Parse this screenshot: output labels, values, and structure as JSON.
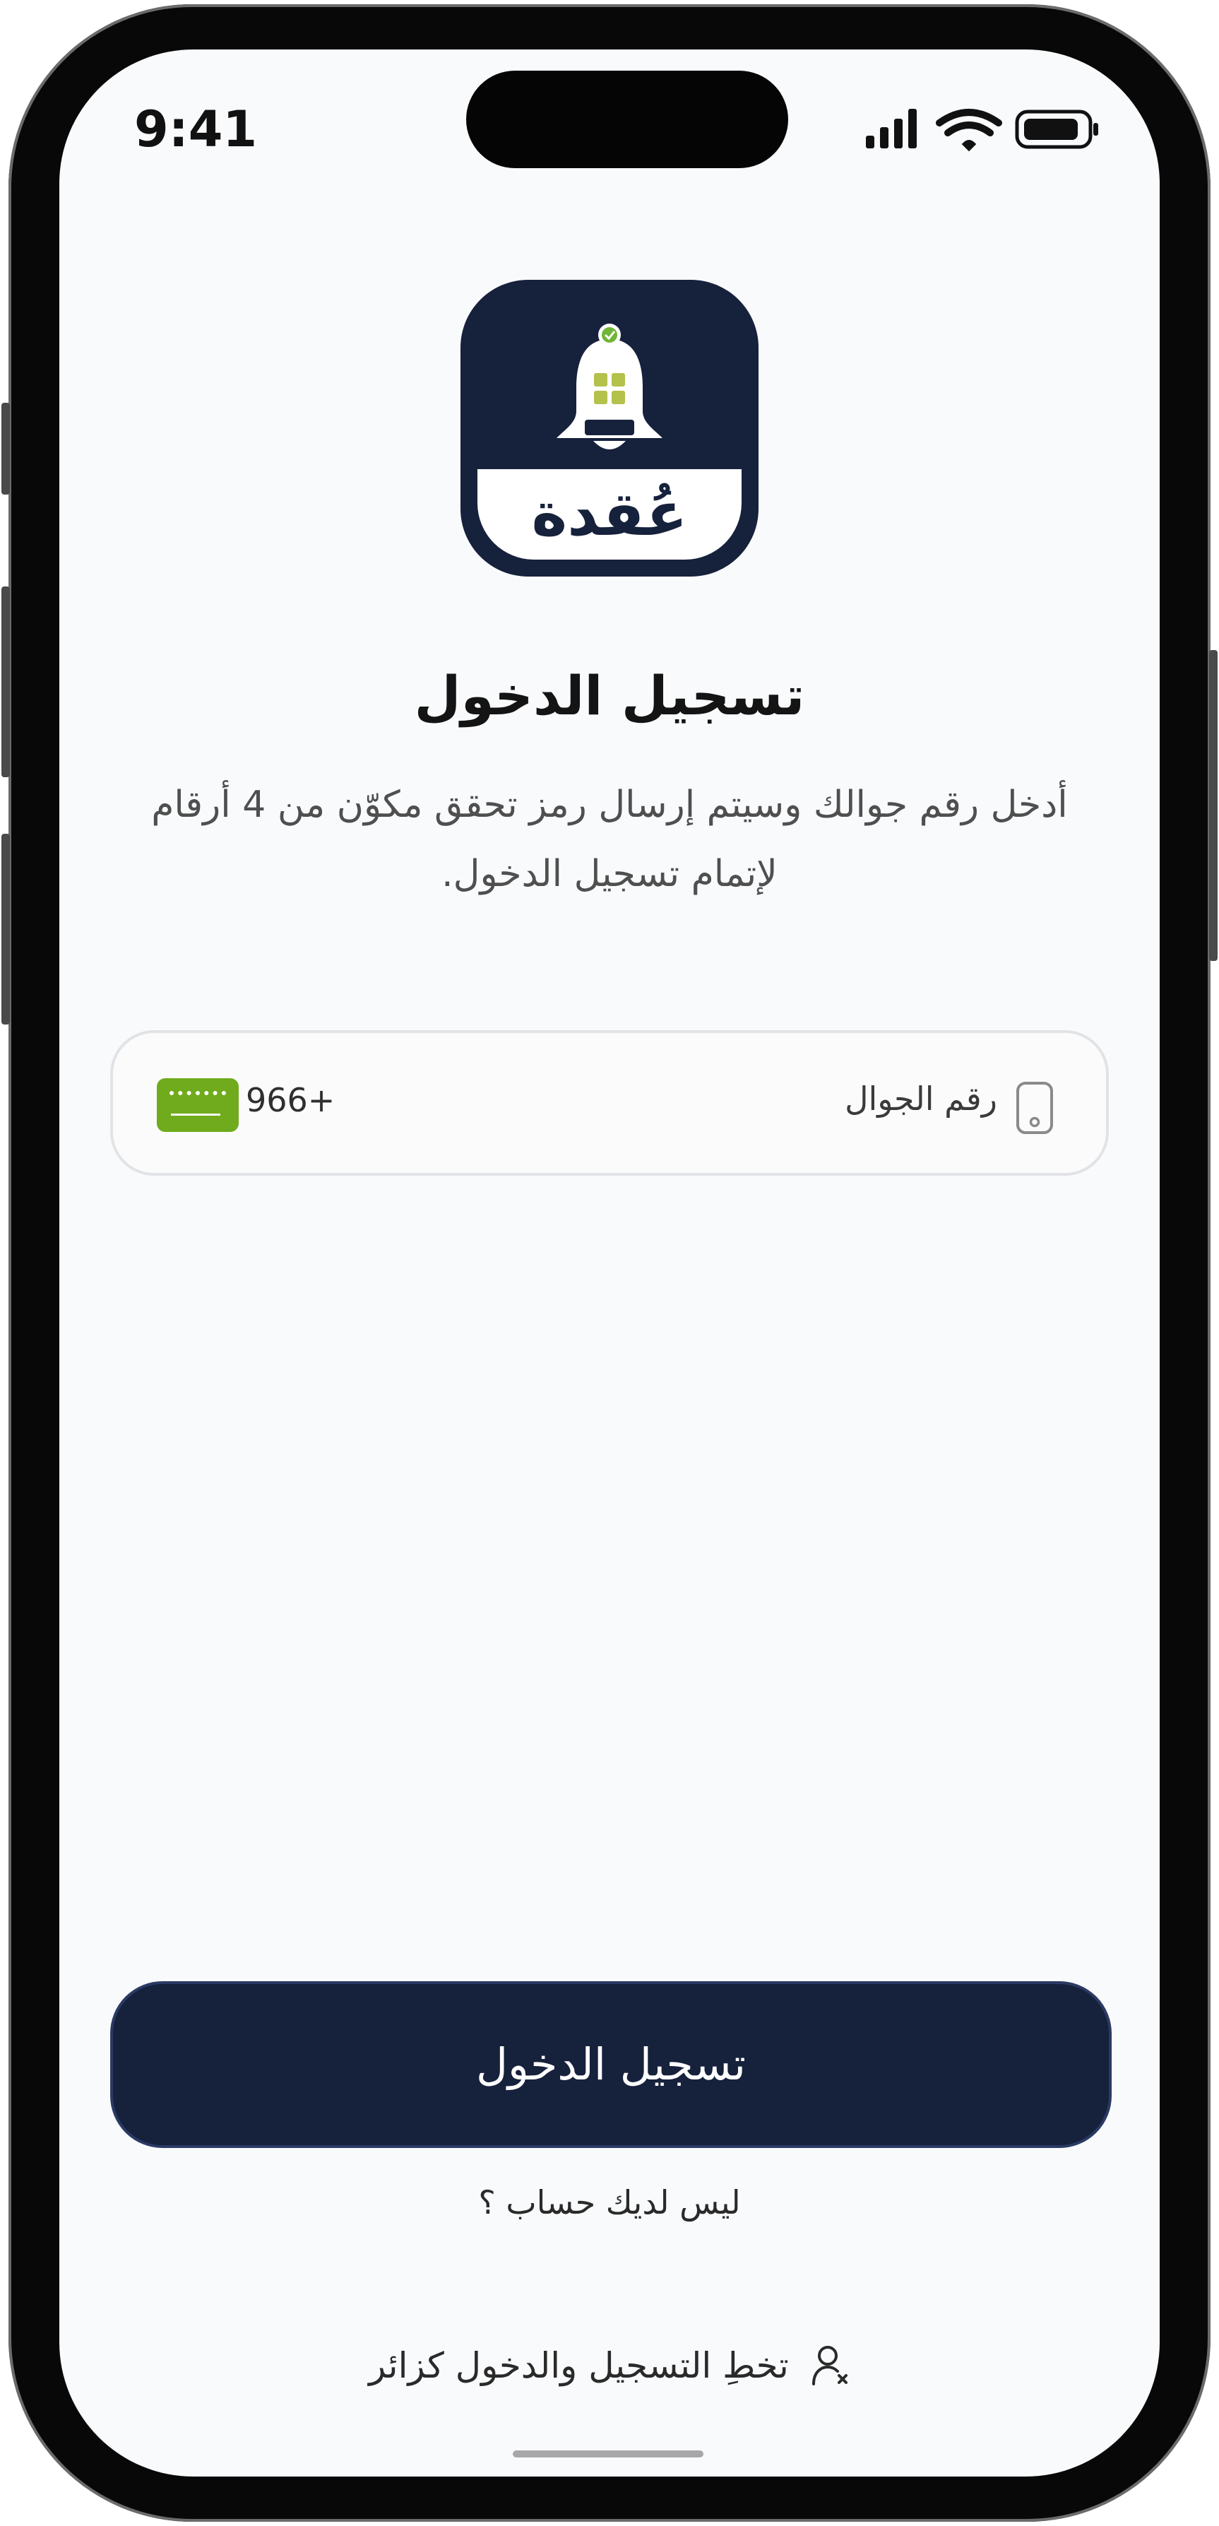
{
  "status_bar": {
    "time": "9:41",
    "signal_icon": "cellular-signal-icon",
    "wifi_icon": "wifi-icon",
    "battery_icon": "battery-icon"
  },
  "app": {
    "logo_text": "عُقدة",
    "logo_icon": "bell-icon",
    "brand_color": "#16213c"
  },
  "login": {
    "title": "تسجيل الدخول",
    "subtitle_line1": "أدخل رقم جوالك وسيتم إرسال رمز تحقق مكوّن من 4 أرقام",
    "subtitle_line2": "لإتمام تسجيل الدخول.",
    "phone_field": {
      "placeholder": "رقم الجوال",
      "value": "",
      "country_code": "966+",
      "flag_icon": "saudi-flag-icon",
      "field_icon": "mobile-phone-icon"
    },
    "submit_label": "تسجيل الدخول",
    "no_account_text": "ليس لديك حساب ؟",
    "guest_label": "تخطِ التسجيل والدخول كزائر",
    "guest_icon": "user-guest-icon"
  }
}
